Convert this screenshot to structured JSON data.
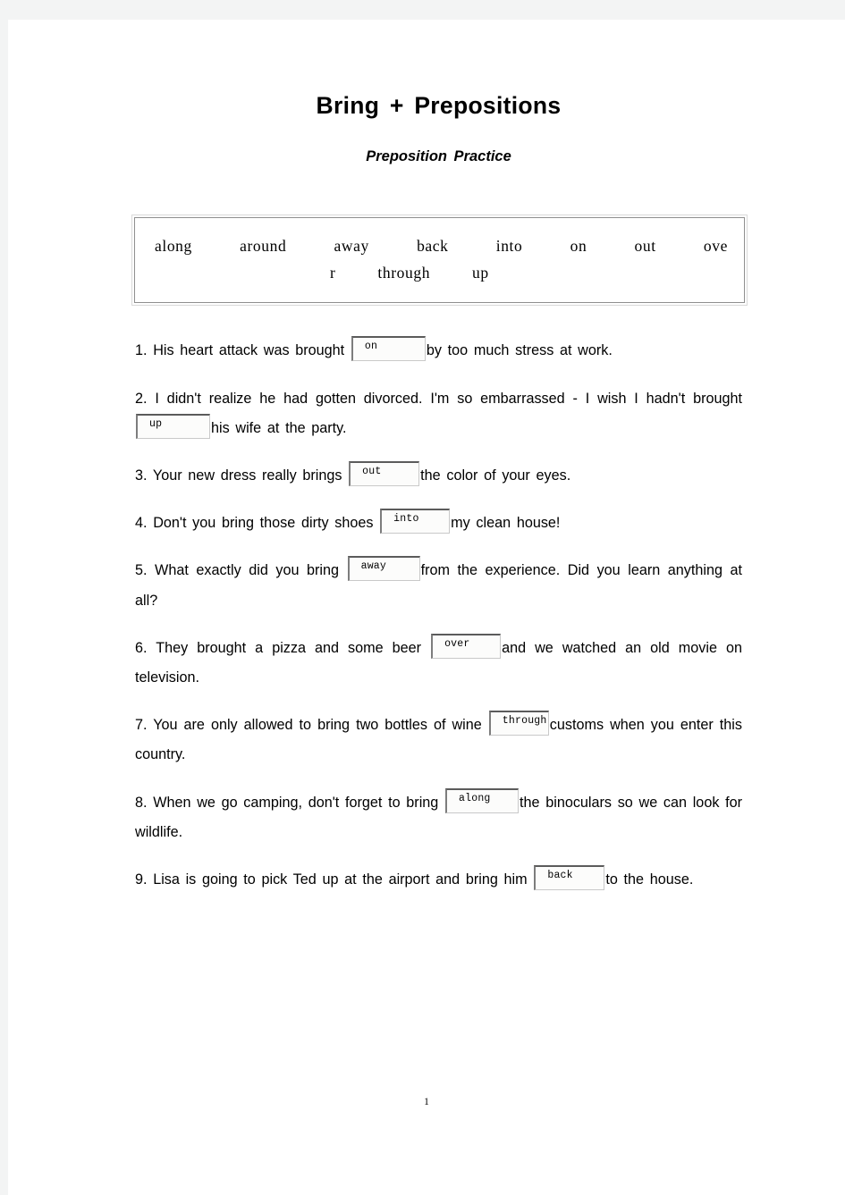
{
  "document": {
    "title": "Bring + Prepositions",
    "subtitle": "Preposition Practice",
    "page_number": "1"
  },
  "word_bank": {
    "line1": "along around away back into on out ove",
    "line2": "r through up",
    "words": [
      "along",
      "around",
      "away",
      "back",
      "into",
      "on",
      "out",
      "over",
      "through",
      "up"
    ]
  },
  "exercises": [
    {
      "number": "1.",
      "before": "1. His heart attack was brought",
      "answer": "on",
      "after": "by too much stress at work."
    },
    {
      "number": "2.",
      "before": "2. I didn't realize he had gotten divorced. I'm so embarrassed - I wish I hadn't brought",
      "answer": "up",
      "after": "his wife at the party."
    },
    {
      "number": "3.",
      "before": "3. Your new dress really brings",
      "answer": "out",
      "after": "the color of your eyes."
    },
    {
      "number": "4.",
      "before": "4. Don't you bring those dirty shoes",
      "answer": "into",
      "after": "my clean house!"
    },
    {
      "number": "5.",
      "before": "5. What exactly did you bring",
      "answer": "away",
      "after": "from the experience. Did you learn anything at all?"
    },
    {
      "number": "6.",
      "before": "6. They brought a pizza and some beer",
      "answer": "over",
      "after": "and we watched an old movie on television."
    },
    {
      "number": "7.",
      "before": "7. You are only allowed to bring two bottles of wine",
      "answer": "through",
      "after": "customs when you enter this country."
    },
    {
      "number": "8.",
      "before": "8. When we go camping, don't forget to bring",
      "answer": "along",
      "after": "the binoculars so we can look for wildlife."
    },
    {
      "number": "9.",
      "before": "9. Lisa is going to pick Ted up at the airport and bring him",
      "answer": "back",
      "after": "to the house."
    }
  ]
}
